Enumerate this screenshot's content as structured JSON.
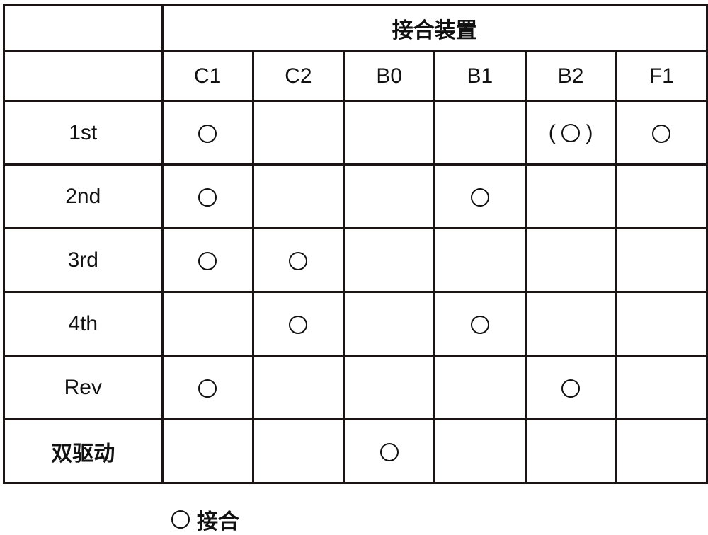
{
  "table": {
    "group_header": "接合装置",
    "columns": [
      "C1",
      "C2",
      "B0",
      "B1",
      "B2",
      "F1"
    ],
    "rows": [
      {
        "label": "1st",
        "bold": false,
        "cells": [
          "O",
          "",
          "",
          "",
          "(O)",
          "O"
        ]
      },
      {
        "label": "2nd",
        "bold": false,
        "cells": [
          "O",
          "",
          "",
          "O",
          "",
          ""
        ]
      },
      {
        "label": "3rd",
        "bold": false,
        "cells": [
          "O",
          "O",
          "",
          "",
          "",
          ""
        ]
      },
      {
        "label": "4th",
        "bold": false,
        "cells": [
          "",
          "O",
          "",
          "O",
          "",
          ""
        ]
      },
      {
        "label": "Rev",
        "bold": false,
        "cells": [
          "O",
          "",
          "",
          "",
          "O",
          ""
        ]
      },
      {
        "label": "双驱动",
        "bold": true,
        "cells": [
          "",
          "",
          "O",
          "",
          "",
          ""
        ]
      }
    ]
  },
  "legend": {
    "symbol": "circle-mark",
    "label": "接合"
  }
}
